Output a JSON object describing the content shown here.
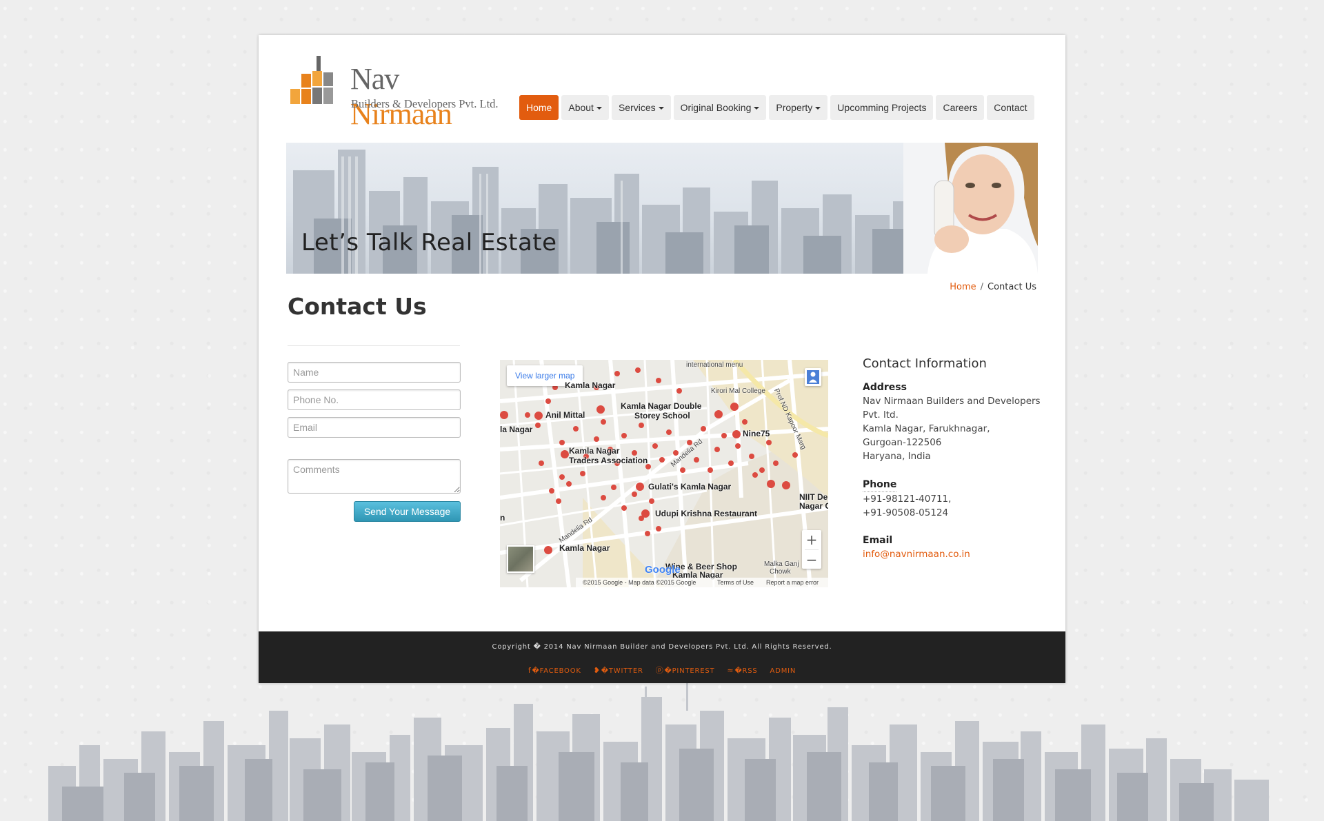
{
  "logo": {
    "name_part1": "Nav",
    "name_part2": "Nirmaan",
    "tagline": "Builders & Developers Pvt. Ltd."
  },
  "nav": {
    "items": [
      {
        "label": "Home",
        "active": true,
        "dropdown": false
      },
      {
        "label": "About",
        "active": false,
        "dropdown": true
      },
      {
        "label": "Services",
        "active": false,
        "dropdown": true
      },
      {
        "label": "Original Booking",
        "active": false,
        "dropdown": true
      },
      {
        "label": "Property",
        "active": false,
        "dropdown": true
      },
      {
        "label": "Upcomming Projects",
        "active": false,
        "dropdown": false
      },
      {
        "label": "Careers",
        "active": false,
        "dropdown": false
      },
      {
        "label": "Contact",
        "active": false,
        "dropdown": false
      }
    ]
  },
  "banner": {
    "title": "Let’s Talk Real Estate"
  },
  "breadcrumb": {
    "home": "Home",
    "separator": "/",
    "current": "Contact Us"
  },
  "page": {
    "title": "Contact Us"
  },
  "form": {
    "name_placeholder": "Name",
    "phone_placeholder": "Phone No.",
    "email_placeholder": "Email",
    "comments_placeholder": "Comments",
    "submit_label": "Send Your Message"
  },
  "map": {
    "view_larger": "View larger map",
    "labels": [
      "Kamla Nagar",
      "Kirori Mal College",
      "Prof ND Kapoor Marg",
      "Anil Mittal",
      "Kamla Nagar Double",
      "Storey School",
      "Mandelia Rd",
      "Nine75",
      "Kamla Nagar",
      "Traders Association",
      "Gulati's Kamla Nagar",
      "NIIT De",
      "Nagar C",
      "Udupi Krishna Restaurant",
      "Mandelia Rd",
      "Kamla Nagar",
      "Wine & Beer Shop",
      "Kamla Nagar",
      "Malka Ganj",
      "Chowk",
      "international menu",
      "la Nagar",
      "n"
    ],
    "google_logo": "Google",
    "footer_copyright": "©2015 Google - Map data ©2015 Google",
    "footer_terms": "Terms of Use",
    "footer_report": "Report a map error",
    "zoom_in": "+",
    "zoom_out": "−"
  },
  "contact": {
    "heading": "Contact Information",
    "address_label": "Address",
    "address_lines": [
      "Nav Nirmaan Builders and Developers",
      "Pvt. ltd.",
      "Kamla Nagar, Farukhnagar,",
      "Gurgoan-122506",
      "Haryana, India"
    ],
    "phone_label": "Phone",
    "phones": [
      "+91-98121-40711,",
      "+91-90508-05124"
    ],
    "email_label": "Email",
    "email": "info@navnirmaan.co.in"
  },
  "footer": {
    "copyright": "Copyright � 2014 Nav Nirmaan Builder and Developers Pvt. Ltd. All Rights Reserved.",
    "links": [
      {
        "icon": "facebook-icon",
        "glyph": "f",
        "label": "�FACEBOOK"
      },
      {
        "icon": "twitter-icon",
        "glyph": "❥",
        "label": "�TWITTER"
      },
      {
        "icon": "pinterest-icon",
        "glyph": "ⓟ",
        "label": "�PINTEREST"
      },
      {
        "icon": "rss-icon",
        "glyph": "≈",
        "label": "�RSS"
      },
      {
        "icon": "admin-icon",
        "glyph": "",
        "label": "ADMIN"
      }
    ]
  },
  "colors": {
    "accent": "#e25c0f",
    "logo_orange": "#e8821c",
    "button_blue": "#2f96b4",
    "footer_bg": "#222222"
  }
}
